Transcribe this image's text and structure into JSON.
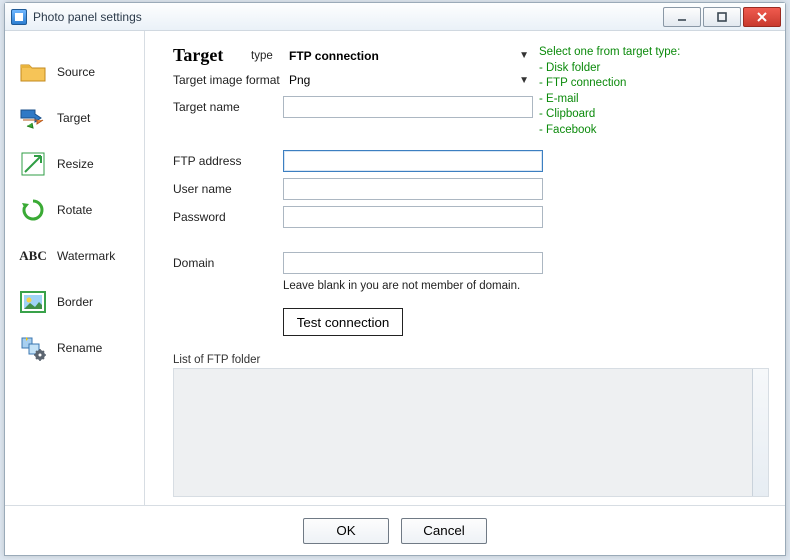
{
  "window": {
    "title": "Photo panel settings"
  },
  "sidebar": {
    "items": [
      {
        "label": "Source",
        "icon": "folder-icon"
      },
      {
        "label": "Target",
        "icon": "target-arrow-icon"
      },
      {
        "label": "Resize",
        "icon": "resize-icon"
      },
      {
        "label": "Rotate",
        "icon": "rotate-icon"
      },
      {
        "label": "Watermark",
        "icon": "watermark-abc-icon"
      },
      {
        "label": "Border",
        "icon": "border-icon"
      },
      {
        "label": "Rename",
        "icon": "rename-gear-icon"
      }
    ]
  },
  "main": {
    "heading": "Target",
    "type_label": "type",
    "type_value": "FTP connection",
    "format_label": "Target image format",
    "format_value": "Png",
    "name_label": "Target name",
    "name_value": "",
    "ftp_address_label": "FTP address",
    "ftp_address_value": "",
    "user_label": "User name",
    "user_value": "",
    "password_label": "Password",
    "password_value": "",
    "domain_label": "Domain",
    "domain_value": "",
    "domain_hint": "Leave blank in you are not member of domain.",
    "test_button": "Test connection",
    "list_label": "List of FTP folder"
  },
  "hints": {
    "title": "Select one from target type:",
    "items": [
      "Disk folder",
      "FTP connection",
      "E-mail",
      "Clipboard",
      "Facebook"
    ]
  },
  "footer": {
    "ok": "OK",
    "cancel": "Cancel"
  }
}
